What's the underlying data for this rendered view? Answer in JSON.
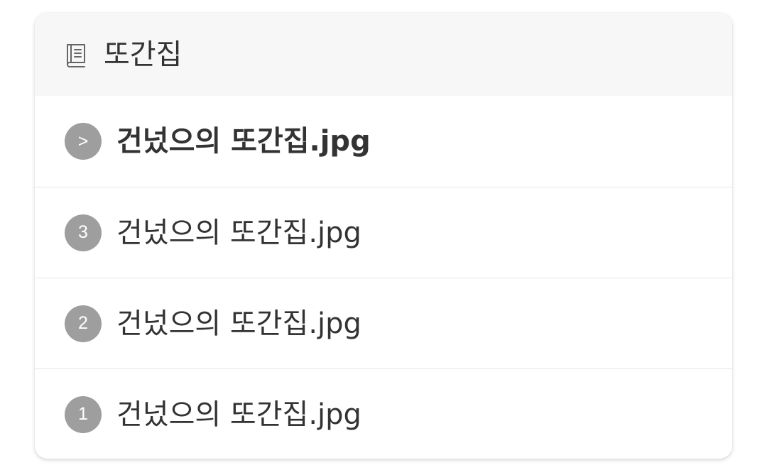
{
  "header": {
    "icon": "book-icon",
    "title": "또간집"
  },
  "items": [
    {
      "badge": ">",
      "label": "건넜으의 또간집.jpg",
      "current": true,
      "badge_icon": "chevron-right-icon"
    },
    {
      "badge": "3",
      "label": "건넜으의 또간집.jpg",
      "current": false
    },
    {
      "badge": "2",
      "label": "건넜으의 또간집.jpg",
      "current": false
    },
    {
      "badge": "1",
      "label": "건넜으의 또간집.jpg",
      "current": false
    }
  ],
  "colors": {
    "header_bg": "#f7f7f7",
    "badge_bg": "#9e9e9e",
    "text": "#333333",
    "divider": "#e6e6e6"
  }
}
